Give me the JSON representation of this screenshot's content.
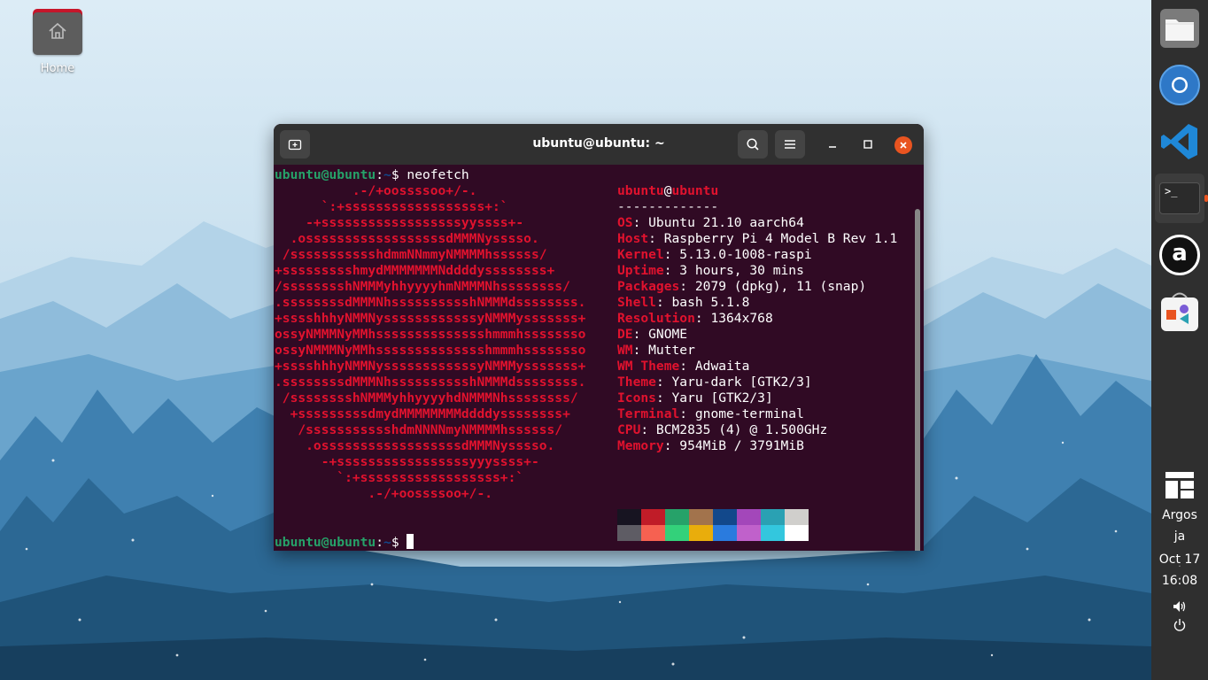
{
  "desktop": {
    "home_label": "Home"
  },
  "terminal": {
    "title": "ubuntu@ubuntu: ~",
    "prompt_user": "ubuntu@ubuntu",
    "prompt_colon": ":",
    "prompt_path": "~",
    "prompt_symbol": "$",
    "command": " neofetch",
    "logo_lines": [
      "          .-/+oossssoo+/-.",
      "      `:+ssssssssssssssssss+:`",
      "    -+ssssssssssssssssssyyssss+-",
      "  .ossssssssssssssssssdMMMNysssso.",
      " /ssssssssssshdmmNNmmyNMMMMhssssss/",
      "+ssssssssshmydMMMMMMMNddddyssssssss+",
      "/sssssssshNMMMyhhyyyyhmNMMMNhssssssss/",
      ".ssssssssdMMMNhsssssssssshNMMMdssssssss.",
      "+sssshhhyNMMNyssssssssssssyNMMMysssssss+",
      "ossyNMMMNyMMhsssssssssssssshmmmhssssssso",
      "ossyNMMMNyMMhsssssssssssssshmmmhssssssso",
      "+sssshhhyNMMNyssssssssssssyNMMMysssssss+",
      ".ssssssssdMMMNhsssssssssshNMMMdssssssss.",
      " /sssssssshNMMMyhhyyyyhdNMMMNhssssssss/",
      "  +sssssssssdmydMMMMMMMMddddyssssssss+",
      "   /ssssssssssshdmNNNNmyNMMMMhssssss/",
      "    .ossssssssssssssssssdMMMNysssso.",
      "      -+sssssssssssssssssyyyssss+-",
      "        `:+ssssssssssssssssss+:`",
      "            .-/+oossssoo+/-."
    ],
    "info_user": "ubuntu",
    "info_at": "@",
    "info_host": "ubuntu",
    "info_separator": "-------------",
    "info": [
      {
        "key": "OS",
        "value": ": Ubuntu 21.10 aarch64"
      },
      {
        "key": "Host",
        "value": ": Raspberry Pi 4 Model B Rev 1.1"
      },
      {
        "key": "Kernel",
        "value": ": 5.13.0-1008-raspi"
      },
      {
        "key": "Uptime",
        "value": ": 3 hours, 30 mins"
      },
      {
        "key": "Packages",
        "value": ": 2079 (dpkg), 11 (snap)"
      },
      {
        "key": "Shell",
        "value": ": bash 5.1.8"
      },
      {
        "key": "Resolution",
        "value": ": 1364x768"
      },
      {
        "key": "DE",
        "value": ": GNOME"
      },
      {
        "key": "WM",
        "value": ": Mutter"
      },
      {
        "key": "WM Theme",
        "value": ": Adwaita"
      },
      {
        "key": "Theme",
        "value": ": Yaru-dark [GTK2/3]"
      },
      {
        "key": "Icons",
        "value": ": Yaru [GTK2/3]"
      },
      {
        "key": "Terminal",
        "value": ": gnome-terminal"
      },
      {
        "key": "CPU",
        "value": ": BCM2835 (4) @ 1.500GHz"
      },
      {
        "key": "Memory",
        "value": ": 954MiB / 3791MiB"
      }
    ],
    "palette_row1": [
      "#171421",
      "#c01c28",
      "#26a269",
      "#a2734c",
      "#12488b",
      "#a347ba",
      "#2aa1b3",
      "#d0cfcc"
    ],
    "palette_row2": [
      "#5e5c64",
      "#f66151",
      "#33d17a",
      "#e9ad0c",
      "#2a7bde",
      "#c061cb",
      "#33c7de",
      "#ffffff"
    ]
  },
  "dock": {
    "apps": [
      {
        "name": "files-icon"
      },
      {
        "name": "chromium-icon"
      },
      {
        "name": "vscode-icon"
      },
      {
        "name": "terminal-icon"
      },
      {
        "name": "amazon-icon"
      },
      {
        "name": "app-center-icon"
      }
    ],
    "terminal_glyph": ">_",
    "amazon_glyph": "a",
    "argos_label": "Argos",
    "lang": "ja",
    "date": "Oct 17",
    "time": "16:08"
  }
}
